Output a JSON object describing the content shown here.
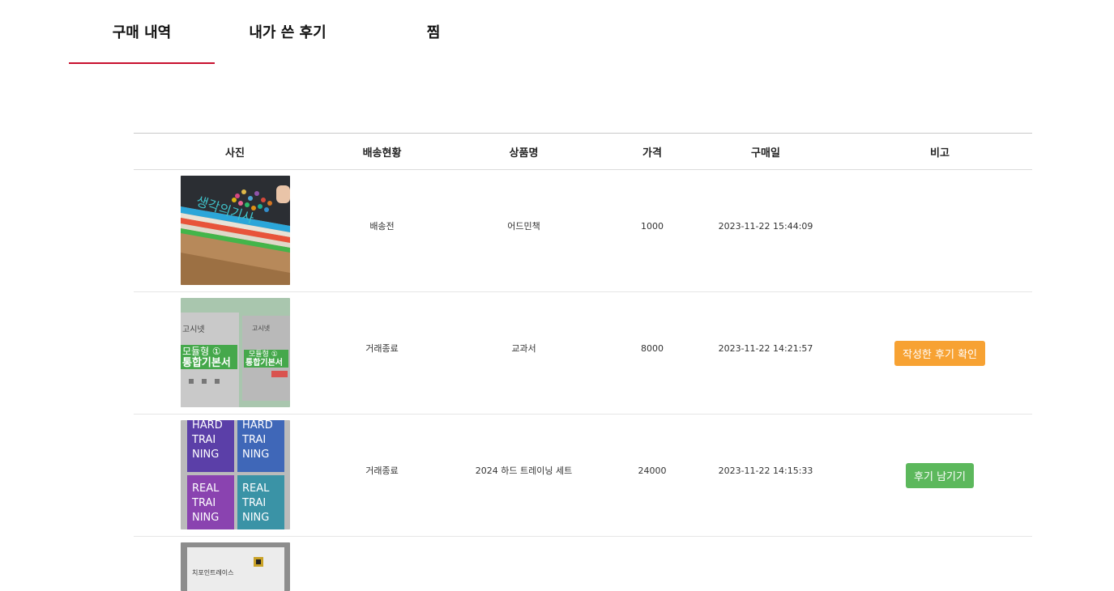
{
  "tabs": [
    {
      "label": "구매 내역",
      "active": true
    },
    {
      "label": "내가 쓴 후기",
      "active": false
    },
    {
      "label": "찜",
      "active": false
    }
  ],
  "accent_color": "#c8102e",
  "table": {
    "headers": [
      "사진",
      "배송현황",
      "상품명",
      "가격",
      "구매일",
      "비고"
    ],
    "rows": [
      {
        "photo": "book-photo-1",
        "status": "배송전",
        "name": "어드민책",
        "price": "1000",
        "date": "2023-11-22 15:44:09",
        "action": ""
      },
      {
        "photo": "book-photo-2",
        "status": "거래종료",
        "name": "교과서",
        "price": "8000",
        "date": "2023-11-22 14:21:57",
        "action": "작성한 후기 확인",
        "action_color": "#f7a233"
      },
      {
        "photo": "book-photo-3",
        "status": "거래종료",
        "name": "2024 하드 트레이닝 세트",
        "price": "24000",
        "date": "2023-11-22 14:15:33",
        "action": "후기 남기기",
        "action_color": "#5cb85c"
      },
      {
        "photo": "book-photo-4",
        "status": "",
        "name": "",
        "price": "",
        "date": "",
        "action": ""
      }
    ]
  },
  "thumb_text": {
    "photo2_book1_top": "고시넷",
    "photo2_book1_mid": "모듈형 ①",
    "photo2_book1_title": "통합기본서",
    "photo2_book2_top": "고시넷",
    "photo2_book2_mid": "모듈형 ①",
    "photo2_book2_title": "통합기본서",
    "photo3_q1": [
      "HARD",
      "TRAI",
      "NING"
    ],
    "photo3_q2": [
      "HARD",
      "TRAI",
      "NING"
    ],
    "photo3_q3": [
      "REAL",
      "TRAI",
      "NING"
    ],
    "photo3_q4": [
      "REAL",
      "TRAI",
      "NING"
    ],
    "photo4_text": "치포인트레이스"
  }
}
